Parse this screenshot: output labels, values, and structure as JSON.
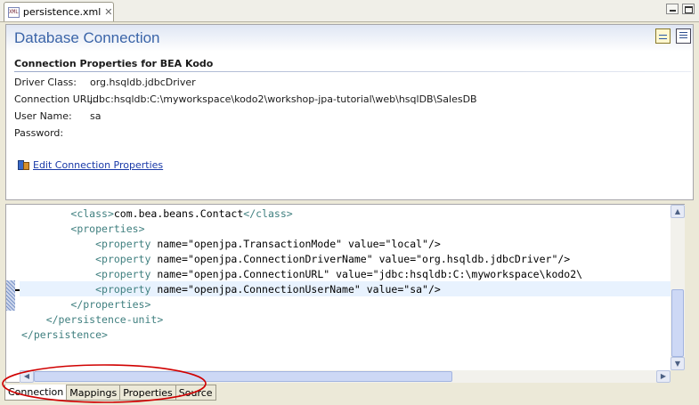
{
  "editor": {
    "tab_label": "persistence.xml",
    "tab_icon": "xml-file-icon",
    "tab_icon_text": "XML"
  },
  "form": {
    "title": "Database Connection",
    "section_title": "Connection Properties for BEA Kodo",
    "properties": [
      {
        "label": "Driver Class:",
        "value": "org.hsqldb.jdbcDriver"
      },
      {
        "label": "Connection URL:",
        "value": "jdbc:hsqldb:C:\\myworkspace\\kodo2\\workshop-jpa-tutorial\\web\\hsqlDB\\SalesDB"
      },
      {
        "label": "User Name:",
        "value": "sa"
      },
      {
        "label": "Password:",
        "value": ""
      }
    ],
    "edit_link": "Edit Connection Properties"
  },
  "code": {
    "lines": [
      "        <class>com.bea.beans.Contact</class>",
      "        <properties>",
      "            <property name=\"openjpa.TransactionMode\" value=\"local\"/>",
      "            <property name=\"openjpa.ConnectionDriverName\" value=\"org.hsqldb.jdbcDriver\"/>",
      "            <property name=\"openjpa.ConnectionURL\" value=\"jdbc:hsqldb:C:\\myworkspace\\kodo2\\",
      "            <property name=\"openjpa.ConnectionUserName\" value=\"sa\"/>",
      "        </properties>",
      "    </persistence-unit>",
      "</persistence>"
    ]
  },
  "page_tabs": [
    "Connection",
    "Mappings",
    "Properties",
    "Source"
  ],
  "active_page_tab": "Connection",
  "colors": {
    "form_title": "#3a64a8",
    "xml_tag": "#3f7f7f",
    "xml_attr": "#7f007f",
    "xml_value": "#2a00ff",
    "annotation": "#d00000"
  }
}
